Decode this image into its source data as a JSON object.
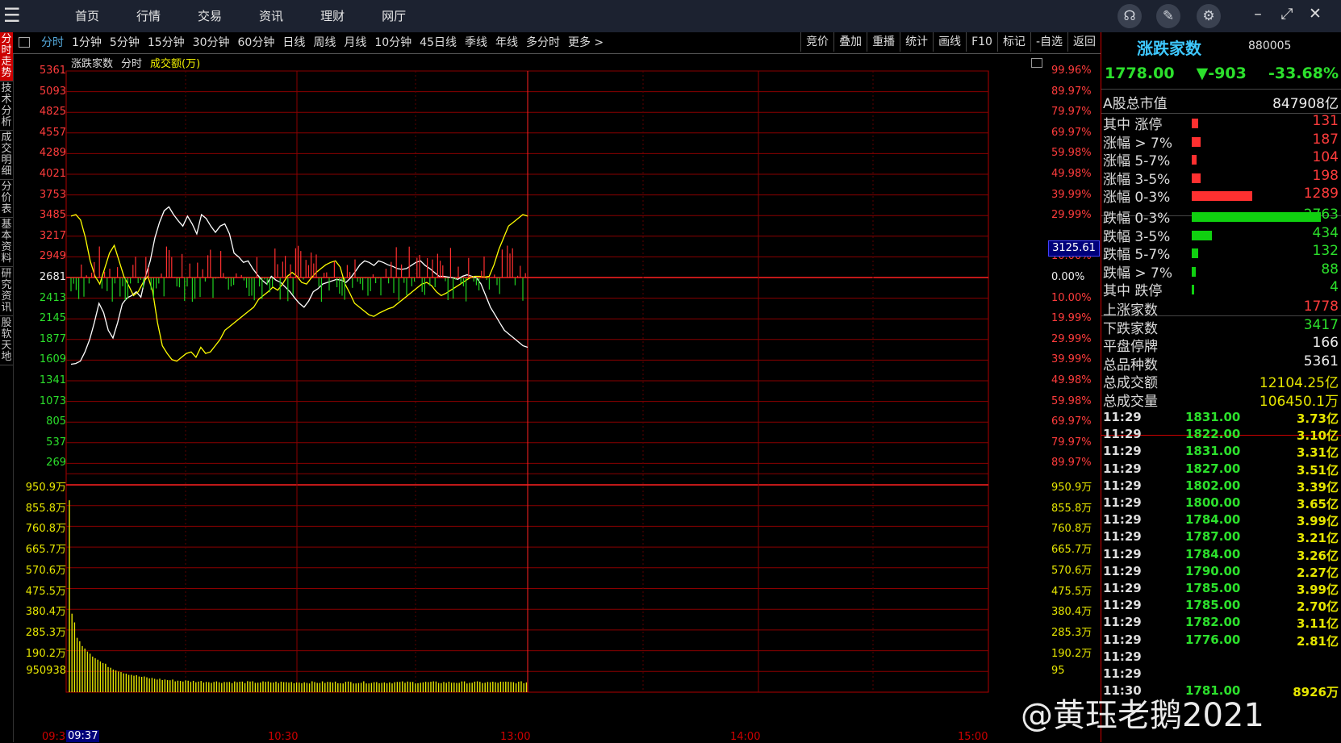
{
  "topbar": {
    "nav": [
      "首页",
      "行情",
      "交易",
      "资讯",
      "理财",
      "网厅"
    ]
  },
  "left_tabs": [
    "分时走势",
    "技术分析",
    "成交明细",
    "分价表",
    "基本资料",
    "研究资讯",
    "股软天地"
  ],
  "toolbar": {
    "periods": [
      "分时",
      "1分钟",
      "5分钟",
      "15分钟",
      "30分钟",
      "60分钟",
      "日线",
      "周线",
      "月线",
      "10分钟",
      "45日线",
      "季线",
      "年线",
      "多分时",
      "更多 >"
    ],
    "tools": [
      "竞价",
      "叠加",
      "重播",
      "统计",
      "画线",
      "F10",
      "标记",
      "-自选",
      "返回"
    ]
  },
  "chart_header": {
    "name": "涨跌家数",
    "mode": "分时",
    "series2": "成交额(万)"
  },
  "price_axis": {
    "left": [
      "5361",
      "5093",
      "4825",
      "4557",
      "4289",
      "4021",
      "3753",
      "3485",
      "3217",
      "2949",
      "2681",
      "2413",
      "2145",
      "1877",
      "1609",
      "1341",
      "1073",
      "805",
      "537",
      "269"
    ],
    "right": [
      "99.96%",
      "89.97%",
      "79.97%",
      "69.97%",
      "59.98%",
      "49.98%",
      "39.99%",
      "29.99%",
      "10.00%",
      "0.00%",
      "10.00%",
      "19.99%",
      "29.99%",
      "39.99%",
      "49.98%",
      "59.98%",
      "69.97%",
      "79.97%",
      "89.97%"
    ],
    "current_value": "3125.61"
  },
  "volume_axis": {
    "left": [
      "950.9万",
      "855.8万",
      "760.8万",
      "665.7万",
      "570.6万",
      "475.5万",
      "380.4万",
      "285.3万",
      "190.2万",
      "950938"
    ],
    "right": [
      "950.9万",
      "855.8万",
      "760.8万",
      "665.7万",
      "570.6万",
      "475.5万",
      "380.4万",
      "285.3万",
      "190.2万",
      "95"
    ]
  },
  "time_axis": {
    "labels": [
      "09:30",
      "10:30",
      "13:00",
      "14:00",
      "15:00"
    ],
    "cursor": "09:37"
  },
  "right_panel": {
    "title": "涨跌家数",
    "code": "880005",
    "price": "1778.00",
    "change": "▼-903",
    "change_pct": "-33.68%",
    "total_mv_label": "A股总市值",
    "total_mv_value": "847908亿",
    "up_rows": [
      {
        "label": "其中 涨停",
        "value": "131",
        "count": 131
      },
      {
        "label": "涨幅 > 7%",
        "value": "187",
        "count": 187
      },
      {
        "label": "涨幅 5-7%",
        "value": "104",
        "count": 104
      },
      {
        "label": "涨幅 3-5%",
        "value": "198",
        "count": 198
      },
      {
        "label": "涨幅 0-3%",
        "value": "1289",
        "count": 1289
      }
    ],
    "down_rows": [
      {
        "label": "跌幅 0-3%",
        "value": "2763",
        "count": 2763
      },
      {
        "label": "跌幅 3-5%",
        "value": "434",
        "count": 434
      },
      {
        "label": "跌幅 5-7%",
        "value": "132",
        "count": 132
      },
      {
        "label": "跌幅 > 7%",
        "value": "88",
        "count": 88
      },
      {
        "label": "其中 跌停",
        "value": "4",
        "count": 4
      }
    ],
    "stats": [
      {
        "label": "上涨家数",
        "value": "1778",
        "color": "#ff3c3c"
      },
      {
        "label": "下跌家数",
        "value": "3417",
        "color": "#2ce02c"
      },
      {
        "label": "平盘停牌",
        "value": "166",
        "color": "#eeeeee"
      },
      {
        "label": "总品种数",
        "value": "5361",
        "color": "#eeeeee"
      },
      {
        "label": "总成交额",
        "value": "12104.25亿",
        "color": "#e6e600"
      },
      {
        "label": "总成交量",
        "value": "106450.1万",
        "color": "#e6e600"
      }
    ],
    "ticks": [
      {
        "time": "11:29",
        "price": "1831.00",
        "amount": "3.73亿"
      },
      {
        "time": "11:29",
        "price": "1822.00",
        "amount": "3.10亿"
      },
      {
        "time": "11:29",
        "price": "1831.00",
        "amount": "3.31亿"
      },
      {
        "time": "11:29",
        "price": "1827.00",
        "amount": "3.51亿"
      },
      {
        "time": "11:29",
        "price": "1802.00",
        "amount": "3.39亿"
      },
      {
        "time": "11:29",
        "price": "1800.00",
        "amount": "3.65亿"
      },
      {
        "time": "11:29",
        "price": "1784.00",
        "amount": "3.99亿"
      },
      {
        "time": "11:29",
        "price": "1787.00",
        "amount": "3.21亿"
      },
      {
        "time": "11:29",
        "price": "1784.00",
        "amount": "3.26亿"
      },
      {
        "time": "11:29",
        "price": "1790.00",
        "amount": "2.27亿"
      },
      {
        "time": "11:29",
        "price": "1785.00",
        "amount": "3.99亿"
      },
      {
        "time": "11:29",
        "price": "1785.00",
        "amount": "2.70亿"
      },
      {
        "time": "11:29",
        "price": "1782.00",
        "amount": "3.11亿"
      },
      {
        "time": "11:29",
        "price": "1776.00",
        "amount": "2.81亿"
      },
      {
        "time": "11:29",
        "price": "",
        "amount": ""
      },
      {
        "time": "11:29",
        "price": "",
        "amount": ""
      },
      {
        "time": "11:30",
        "price": "1781.00",
        "amount": "8926万"
      }
    ]
  },
  "watermark": "@黄珏老鹅2021",
  "chart_data": {
    "type": "line",
    "x_range": [
      "09:30",
      "15:00"
    ],
    "ylim": [
      269,
      5361
    ],
    "base": 2681,
    "series": [
      {
        "color": "#ffffff",
        "values": [
          1560,
          1570,
          1600,
          1720,
          1880,
          2100,
          2350,
          2230,
          2000,
          1900,
          2100,
          2340,
          2420,
          2450,
          2500,
          2430,
          2700,
          2900,
          3200,
          3400,
          3550,
          3600,
          3500,
          3420,
          3350,
          3480,
          3380,
          3250,
          3500,
          3450,
          3350,
          3270,
          3350,
          3380,
          3250,
          3000,
          2950,
          2880,
          2900,
          2800,
          2720,
          2650,
          2600,
          2700,
          2650,
          2620,
          2560,
          2500,
          2420,
          2350,
          2300,
          2380,
          2500,
          2540,
          2600,
          2620,
          2640,
          2660,
          2650,
          2620,
          2680,
          2760,
          2850,
          2900,
          2880,
          2840,
          2900,
          2880,
          2850,
          2830,
          2800,
          2790,
          2800,
          2840,
          2880,
          2900,
          2840,
          2800,
          2750,
          2700,
          2700,
          2690,
          2680,
          2660,
          2700,
          2720,
          2700,
          2680,
          2600,
          2450,
          2300,
          2200,
          2100,
          2000,
          1950,
          1900,
          1850,
          1800,
          1780
        ]
      },
      {
        "color": "#ffff00",
        "values": [
          3480,
          3500,
          3430,
          3200,
          2900,
          2700,
          2600,
          2800,
          3000,
          3100,
          2900,
          2700,
          2580,
          2450,
          2500,
          2620,
          2700,
          2500,
          2100,
          1800,
          1700,
          1620,
          1600,
          1650,
          1700,
          1720,
          1650,
          1780,
          1700,
          1720,
          1800,
          1880,
          2000,
          2050,
          2100,
          2150,
          2200,
          2250,
          2300,
          2400,
          2450,
          2500,
          2560,
          2520,
          2600,
          2700,
          2750,
          2700,
          2620,
          2600,
          2680,
          2750,
          2800,
          2850,
          2880,
          2900,
          2820,
          2600,
          2480,
          2350,
          2300,
          2250,
          2200,
          2180,
          2220,
          2250,
          2280,
          2300,
          2350,
          2400,
          2450,
          2500,
          2550,
          2600,
          2620,
          2580,
          2500,
          2450,
          2480,
          2520,
          2560,
          2600,
          2640,
          2680,
          2700,
          2700,
          2690,
          2700,
          2850,
          3050,
          3200,
          3350,
          3400,
          3450,
          3500,
          3480
        ]
      }
    ],
    "volume": {
      "ylim": [
        0,
        950.9
      ],
      "unit": "万"
    }
  }
}
